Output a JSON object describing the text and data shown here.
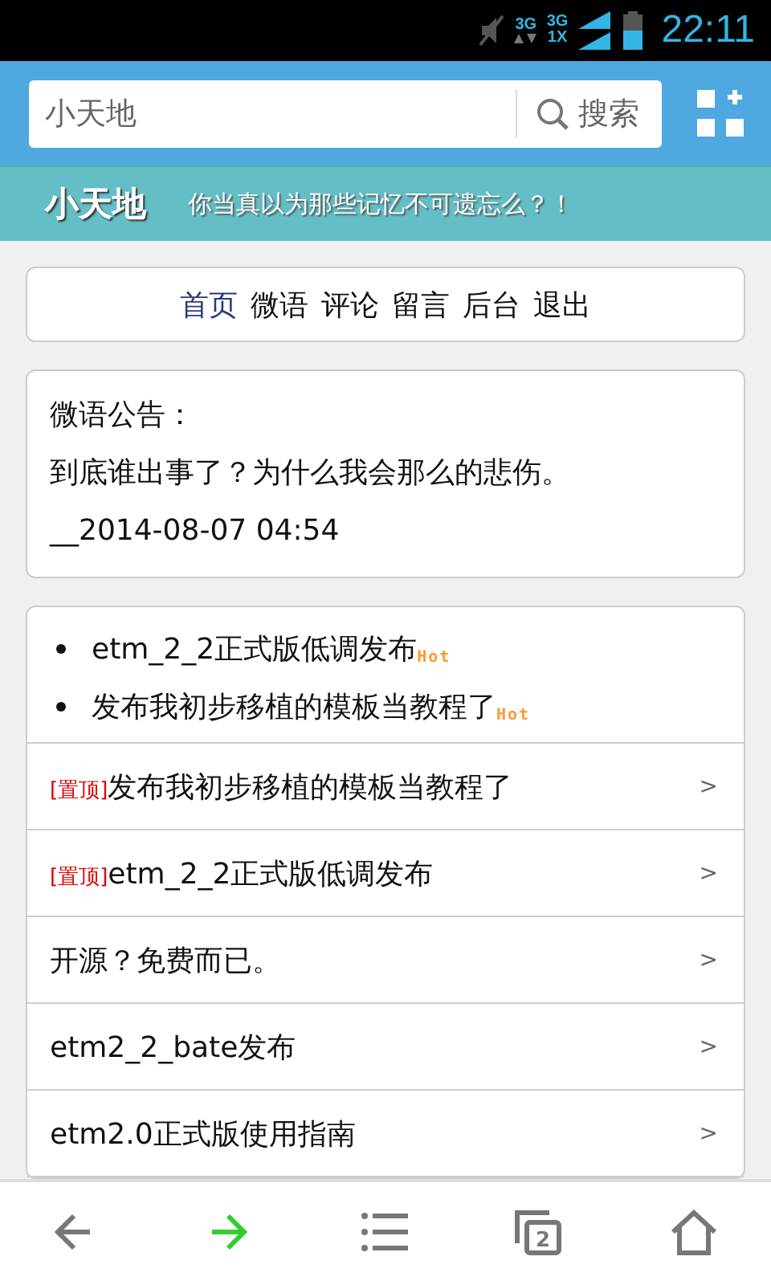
{
  "status_bar": {
    "network_1": "3G",
    "network_2": "3G",
    "network_3": "1X",
    "time": "22:11"
  },
  "search": {
    "value": "小天地",
    "button": "搜索"
  },
  "banner": {
    "title": "小天地",
    "tagline": "你当真以为那些记忆不可遗忘么？！"
  },
  "nav": [
    {
      "label": "首页",
      "selected": true
    },
    {
      "label": "微语",
      "selected": false
    },
    {
      "label": "评论",
      "selected": false
    },
    {
      "label": "留言",
      "selected": false
    },
    {
      "label": "后台",
      "selected": false
    },
    {
      "label": "退出",
      "selected": false
    }
  ],
  "notice": {
    "title": "微语公告：",
    "text": "到底谁出事了？为什么我会那么的悲伤。",
    "date": "__2014-08-07 04:54"
  },
  "hot_list": [
    {
      "title": "etm_2_2正式版低调发布",
      "badge": "Hot"
    },
    {
      "title": "发布我初步移植的模板当教程了",
      "badge": "Hot"
    }
  ],
  "posts": [
    {
      "tag": "[置顶]",
      "title": "发布我初步移植的模板当教程了",
      "arrow": ">"
    },
    {
      "tag": "[置顶]",
      "title": "etm_2_2正式版低调发布",
      "arrow": ">"
    },
    {
      "title": "开源？免费而已。",
      "arrow": ">"
    },
    {
      "title": "etm2_2_bate发布",
      "arrow": ">"
    },
    {
      "title": "etm2.0正式版使用指南",
      "arrow": ">"
    }
  ],
  "toolbar": [
    {
      "kind": "back",
      "active": false
    },
    {
      "kind": "forward",
      "active": true
    },
    {
      "kind": "menu",
      "active": false
    },
    {
      "kind": "tabs",
      "count": "2",
      "active": false
    },
    {
      "kind": "home",
      "active": false
    }
  ]
}
